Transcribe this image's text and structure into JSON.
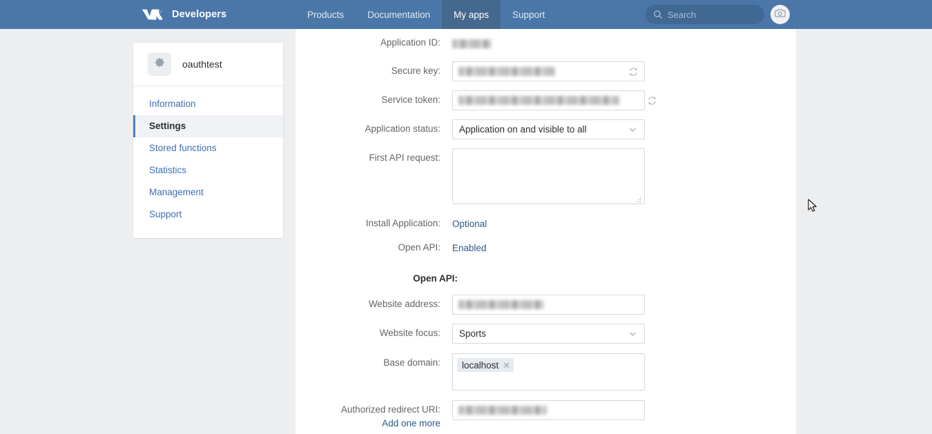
{
  "header": {
    "brand": "Developers",
    "logo_icon": "vk-logo",
    "nav": [
      {
        "label": "Products",
        "active": false
      },
      {
        "label": "Documentation",
        "active": false
      },
      {
        "label": "My apps",
        "active": true
      },
      {
        "label": "Support",
        "active": false
      }
    ],
    "search": {
      "placeholder": "Search",
      "value": "",
      "icon": "search-icon"
    },
    "avatar_icon": "camera-icon"
  },
  "sidebar": {
    "app_name": "oauthtest",
    "app_icon": "gear-icon",
    "items": [
      {
        "label": "Information",
        "active": false
      },
      {
        "label": "Settings",
        "active": true
      },
      {
        "label": "Stored functions",
        "active": false
      },
      {
        "label": "Statistics",
        "active": false
      },
      {
        "label": "Management",
        "active": false
      },
      {
        "label": "Support",
        "active": false
      }
    ]
  },
  "form": {
    "application_id": {
      "label": "Application ID:",
      "value": "",
      "redacted": true
    },
    "secure_key": {
      "label": "Secure key:",
      "value": "",
      "redacted": true,
      "action_icon": "refresh-icon"
    },
    "service_token": {
      "label": "Service token:",
      "value": "",
      "redacted": true,
      "action_icon": "refresh-icon"
    },
    "application_status": {
      "label": "Application status:",
      "value": "Application on and visible to all",
      "chevron_icon": "chevron-down-icon"
    },
    "first_api_request": {
      "label": "First API request:",
      "value": "",
      "placeholder": ""
    },
    "install_application": {
      "label": "Install Application:",
      "value": "Optional"
    },
    "open_api": {
      "label": "Open API:",
      "value": "Enabled"
    },
    "open_api_section_title": "Open API:",
    "website_address": {
      "label": "Website address:",
      "value": "",
      "redacted": true
    },
    "website_focus": {
      "label": "Website focus:",
      "value": "Sports",
      "chevron_icon": "chevron-down-icon"
    },
    "base_domain": {
      "label": "Base domain:",
      "tags": [
        {
          "label": "localhost",
          "remove_icon": "close-icon"
        }
      ]
    },
    "authorized_redirect_uri": {
      "label": "Authorized redirect URI:",
      "value": "",
      "redacted": true,
      "add_more_label": "Add one more"
    }
  },
  "colors": {
    "header_blue": "#4a76a8",
    "header_active_tab": "#45688e",
    "page_bg": "#edeef0",
    "link_blue": "#2a5885",
    "sidebar_link": "#3f6db4",
    "accent_bar": "#5181b8"
  }
}
